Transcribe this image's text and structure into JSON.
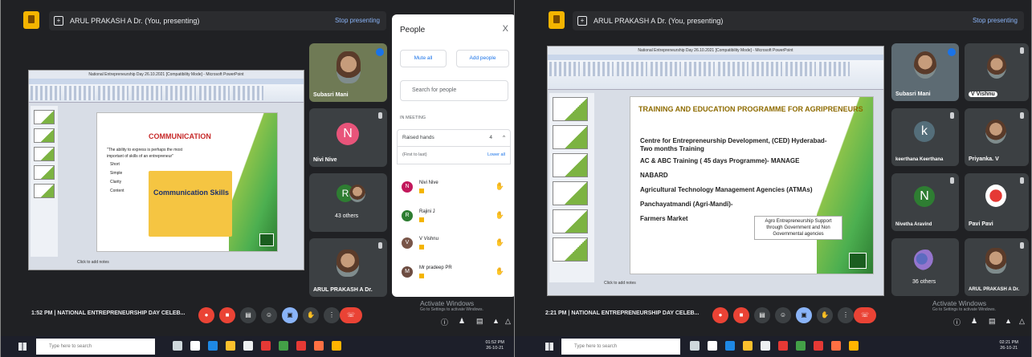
{
  "colors": {
    "meet_bg": "#202124",
    "tile": "#3c4043",
    "end_call": "#ea4335",
    "link": "#1a73e8"
  },
  "left": {
    "presenting_label": "ARUL PRAKASH A Dr. (You, presenting)",
    "stop_label": "Stop presenting",
    "ppt_title": "National Entrepreneurship Day 26.10.2021 [Compatibility Mode] - Microsoft PowerPoint",
    "slide_title": "COMMUNICATION",
    "slide_intro": "\"The ability to express is perhaps the most important of skills of an entrepreneur\"",
    "slide_bullets": [
      "Short",
      "Simple",
      "Clarity",
      "Content"
    ],
    "slide_image_text": "Communication Skills",
    "notes": "Click to add notes",
    "tiles": [
      {
        "name": "Subasri Mani",
        "icon": "person-photo"
      },
      {
        "initial": "N",
        "name": "Nivi Nive",
        "color": "#e8547a"
      },
      {
        "initial": "R",
        "name": "43 others",
        "color": "#2e7d32"
      },
      {
        "name": "ARUL PRAKASH A Dr.",
        "icon": "person-photo"
      }
    ],
    "people": {
      "title": "People",
      "close": "X",
      "mute_all": "Mute all",
      "add_people": "Add people",
      "search_placeholder": "Search for people",
      "in_meeting": "IN MEETING",
      "raised_hands": "Raised hands",
      "raised_count": "4",
      "first_to_last": "(First to last)",
      "lower_all": "Lower all",
      "list": [
        {
          "initial": "N",
          "name": "Nivi Nive",
          "color": "#c2185b"
        },
        {
          "initial": "R",
          "name": "Rajini J",
          "color": "#2e7d32"
        },
        {
          "initial": "V",
          "name": "V Vishnu",
          "color": "#795548"
        },
        {
          "initial": "M",
          "name": "Mr pradeep PR",
          "color": "#6d4c41"
        }
      ]
    },
    "time": "1:52 PM",
    "meeting": "NATIONAL ENTREPRENEURSHIP DAY CELEB...",
    "activate": "Activate Windows",
    "activate_sub": "Go to Settings to activate Windows.",
    "taskbar_search": "Type here to search",
    "clock_time": "01:52 PM",
    "clock_date": "26-10-21"
  },
  "right": {
    "presenting_label": "ARUL PRAKASH A Dr. (You, presenting)",
    "stop_label": "Stop presenting",
    "ppt_title": "National Entrepreneurship Day 26.10.2021 [Compatibility Mode] - Microsoft PowerPoint",
    "slide_title": "TRAINING AND EDUCATION PROGRAMME FOR AGRIPRENEURS",
    "slide_bullets": [
      "Centre for Entrepreneurship Development, (CED) Hyderabad- Two months Training",
      "AC & ABC Training ( 45 days Programme)- MANAGE",
      "NABARD",
      "Agricultural Technology Management Agencies (ATMAs)",
      "Panchayatmandi (Agri-Mandi)-",
      "Farmers Market"
    ],
    "callout": "Agro Entrepreneurship Support through Government and Non Governmental agencies",
    "notes": "Click to add notes",
    "tiles": [
      {
        "name": "Subasri Mani"
      },
      {
        "name": "V Vishnu"
      },
      {
        "initial": "k",
        "name": "keerthana Keerthana",
        "color": "#546e7a"
      },
      {
        "name": "Priyanka. V"
      },
      {
        "initial": "N",
        "name": "Nivetha Aravind",
        "color": "#2e7d32"
      },
      {
        "name": "Pavi Pavi"
      },
      {
        "name": "36 others"
      },
      {
        "name": "ARUL PRAKASH A Dr."
      }
    ],
    "time": "2:21 PM",
    "meeting": "NATIONAL ENTREPRENEURSHIP DAY CELEB...",
    "activate": "Activate Windows",
    "activate_sub": "Go to Settings to activate Windows.",
    "taskbar_search": "Type here to search",
    "clock_time": "02:21 PM",
    "clock_date": "26-10-21"
  }
}
